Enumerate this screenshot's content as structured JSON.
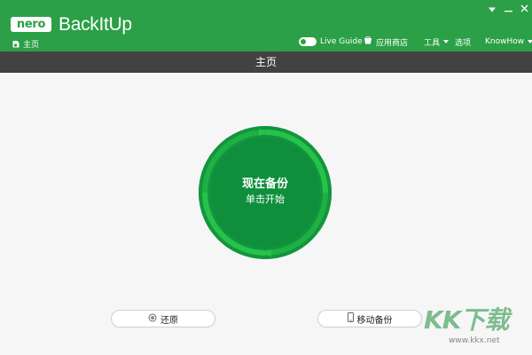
{
  "app": {
    "logo_text": "nero",
    "name": "BackItUp"
  },
  "breadcrumb": {
    "home_label": "主页"
  },
  "menu": {
    "live_guide_label": "Live Guide",
    "live_guide_enabled": true,
    "app_store_label": "应用商店",
    "tools_label": "工具",
    "options_label": "选项",
    "knowhow_label": "KnowHow"
  },
  "section": {
    "title": "主页"
  },
  "backup_button": {
    "title": "现在备份",
    "subtitle": "单击开始"
  },
  "buttons": {
    "restore_label": "还原",
    "mobile_backup_label": "移动备份"
  },
  "watermark": {
    "brand": "KK下载",
    "url": "www.kkx.net"
  },
  "icons": {
    "home": "home-icon",
    "store": "store-icon",
    "restore": "restore-icon",
    "mobile": "phone-icon",
    "window_menu": "window-menu-icon",
    "minimize": "minimize-icon",
    "close": "close-icon"
  },
  "colors": {
    "brand_green": "#2ba046",
    "section_bar": "#424242",
    "circle_green": "#0f8f3b",
    "ring_green": "#27c24a",
    "background": "#f6f6f6"
  }
}
